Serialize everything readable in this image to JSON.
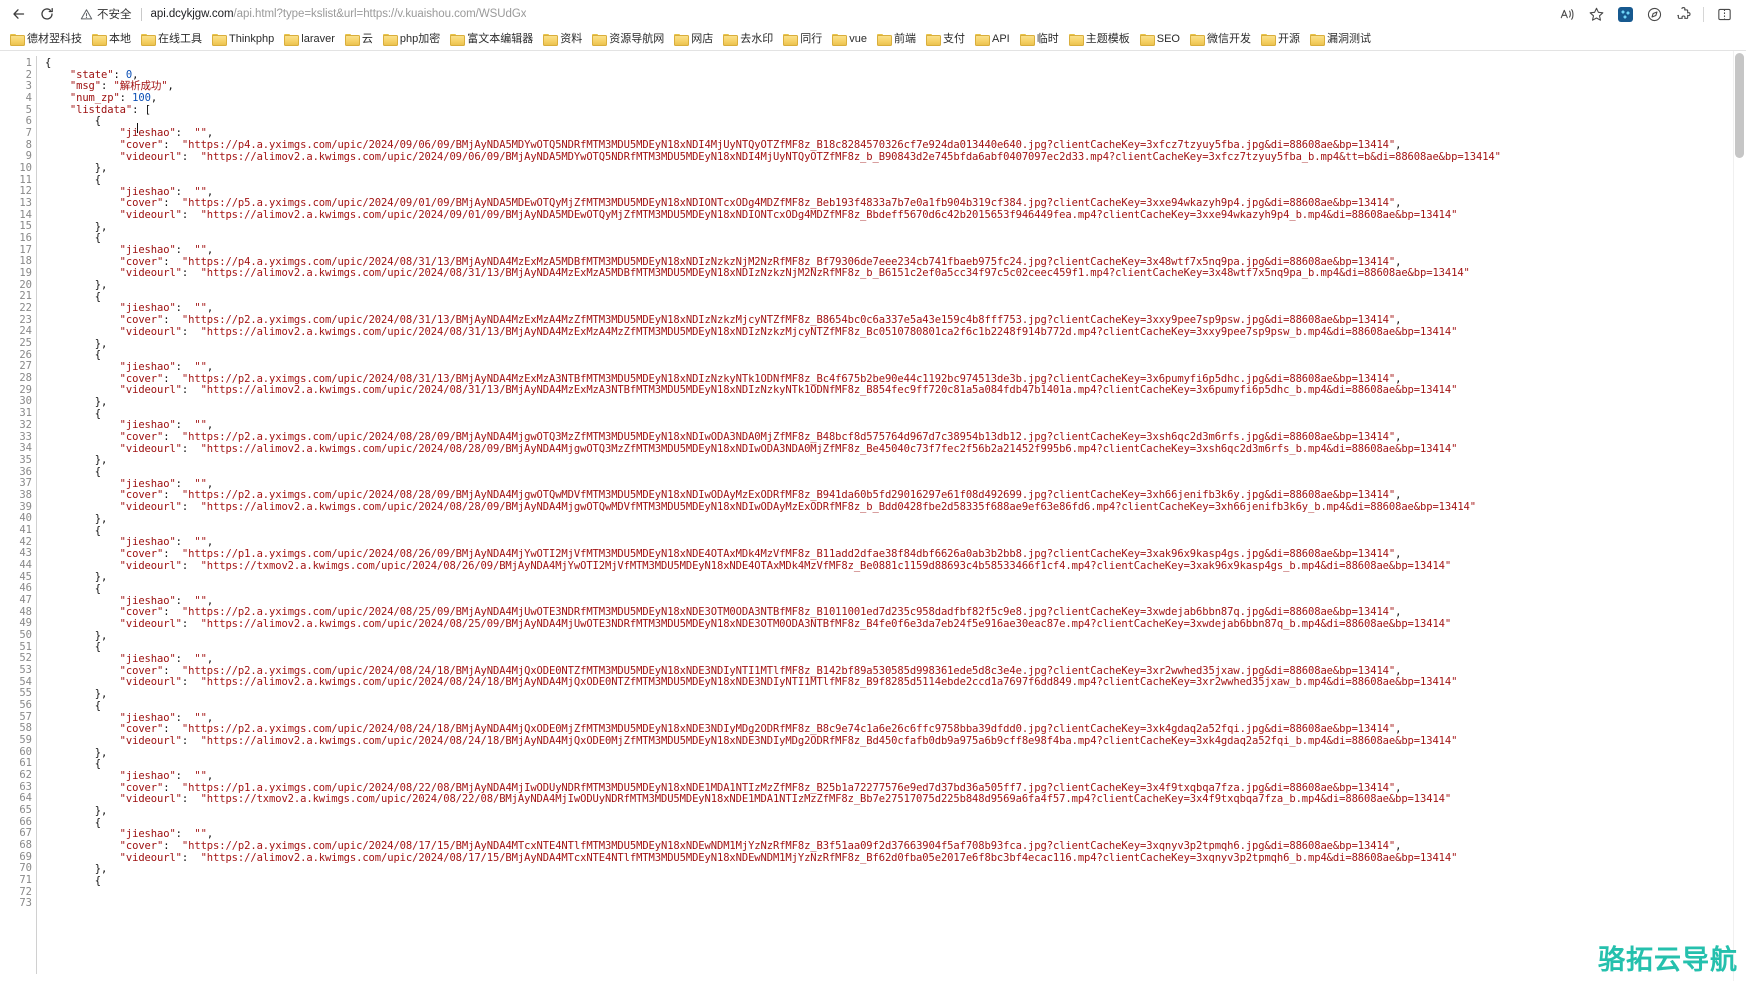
{
  "browser": {
    "back_label": "Back",
    "reload_label": "Reload",
    "security": {
      "warning_icon": "warning-triangle-icon",
      "label": "不安全"
    },
    "url": {
      "host": "api.dcykjgw.com",
      "path": "/api.html?type=kslist&url=https://v.kuaishou.com/WSUdGx",
      "full": "api.dcykjgw.com/api.html?type=kslist&url=https://v.kuaishou.com/WSUdGx"
    },
    "toolbar_right": [
      {
        "name": "read-aloud-icon",
        "glyph": "A"
      },
      {
        "name": "favorite-star-icon",
        "glyph": "☆"
      },
      {
        "name": "extension-blue-icon",
        "glyph": ""
      },
      {
        "name": "collections-icon",
        "glyph": "◎"
      },
      {
        "name": "extensions-puzzle-icon",
        "glyph": "🧩"
      },
      {
        "name": "split-screen-icon",
        "glyph": "▯"
      }
    ],
    "bookmarks": [
      "德材翌科技",
      "本地",
      "在线工具",
      "Thinkphp",
      "laraver",
      "云",
      "php加密",
      "富文本编辑器",
      "资料",
      "资源导航网",
      "网店",
      "去水印",
      "同行",
      "vue",
      "前端",
      "支付",
      "API",
      "临时",
      "主题模板",
      "SEO",
      "微信开发",
      "开源",
      "漏洞测试"
    ]
  },
  "watermark": "骆拓云导航",
  "response": {
    "state": 0,
    "msg": "解析成功",
    "num_zp": 100,
    "items": [
      {
        "jieshao": "",
        "cover": "https://p4.a.yximgs.com/upic/2024/09/06/09/BMjAyNDA5MDYwOTQ5NDRfMTM3MDU5MDEyN18xNDI4MjUyNTQyOTZfMF8z_B18c8284570326cf7e924da013440e640.jpg?clientCacheKey=3xfcz7tzyuy5fba.jpg&di=88608ae&bp=13414",
        "videourl": "https://alimov2.a.kwimgs.com/upic/2024/09/06/09/BMjAyNDA5MDYwOTQ5NDRfMTM3MDU5MDEyN18xNDI4MjUyNTQyOTZfMF8z_b_B90843d2e745bfda6abf0407097ec2d33.mp4?clientCacheKey=3xfcz7tzyuy5fba_b.mp4&tt=b&di=88608ae&bp=13414"
      },
      {
        "jieshao": "",
        "cover": "https://p5.a.yximgs.com/upic/2024/09/01/09/BMjAyNDA5MDEwOTQyMjZfMTM3MDU5MDEyN18xNDIONTcxODg4MDZfMF8z_Beb193f4833a7b7e0a1fb904b319cf384.jpg?clientCacheKey=3xxe94wkazyh9p4.jpg&di=88608ae&bp=13414",
        "videourl": "https://alimov2.a.kwimgs.com/upic/2024/09/01/09/BMjAyNDA5MDEwOTQyMjZfMTM3MDU5MDEyN18xNDIONTcxODg4MDZfMF8z_Bbdeff5670d6c42b2015653f946449fea.mp4?clientCacheKey=3xxe94wkazyh9p4_b.mp4&di=88608ae&bp=13414"
      },
      {
        "jieshao": "",
        "cover": "https://p4.a.yximgs.com/upic/2024/08/31/13/BMjAyNDA4MzExMzA5MDBfMTM3MDU5MDEyN18xNDIzNzkzNjM2NzRfMF8z_Bf79306de7eee234cb741fbaeb975fc24.jpg?clientCacheKey=3x48wtf7x5nq9pa.jpg&di=88608ae&bp=13414",
        "videourl": "https://alimov2.a.kwimgs.com/upic/2024/08/31/13/BMjAyNDA4MzExMzA5MDBfMTM3MDU5MDEyN18xNDIzNzkzNjM2NzRfMF8z_b_B6151c2ef0a5cc34f97c5c02ceec459f1.mp4?clientCacheKey=3x48wtf7x5nq9pa_b.mp4&di=88608ae&bp=13414"
      },
      {
        "jieshao": "",
        "cover": "https://p2.a.yximgs.com/upic/2024/08/31/13/BMjAyNDA4MzExMzA4MzZfMTM3MDU5MDEyN18xNDIzNzkzMjcyNTZfMF8z_B8654bc0c6a337e5a43e159c4b8fff753.jpg?clientCacheKey=3xxy9pee7sp9psw.jpg&di=88608ae&bp=13414",
        "videourl": "https://alimov2.a.kwimgs.com/upic/2024/08/31/13/BMjAyNDA4MzExMzA4MzZfMTM3MDU5MDEyN18xNDIzNzkzMjcyNTZfMF8z_Bc0510780801ca2f6c1b2248f914b772d.mp4?clientCacheKey=3xxy9pee7sp9psw_b.mp4&di=88608ae&bp=13414"
      },
      {
        "jieshao": "",
        "cover": "https://p2.a.yximgs.com/upic/2024/08/31/13/BMjAyNDA4MzExMzA3NTBfMTM3MDU5MDEyN18xNDIzNzkyNTk1ODNfMF8z_Bc4f675b2be90e44c1192bc974513de3b.jpg?clientCacheKey=3x6pumyfi6p5dhc.jpg&di=88608ae&bp=13414",
        "videourl": "https://alimov2.a.kwimgs.com/upic/2024/08/31/13/BMjAyNDA4MzExMzA3NTBfMTM3MDU5MDEyN18xNDIzNzkyNTk1ODNfMF8z_B854fec9ff720c81a5a084fdb47b1401a.mp4?clientCacheKey=3x6pumyfi6p5dhc_b.mp4&di=88608ae&bp=13414"
      },
      {
        "jieshao": "",
        "cover": "https://p2.a.yximgs.com/upic/2024/08/28/09/BMjAyNDA4MjgwOTQ3MzZfMTM3MDU5MDEyN18xNDIwODA3NDA0MjZfMF8z_B48bcf8d575764d967d7c38954b13db12.jpg?clientCacheKey=3xsh6qc2d3m6rfs.jpg&di=88608ae&bp=13414",
        "videourl": "https://alimov2.a.kwimgs.com/upic/2024/08/28/09/BMjAyNDA4MjgwOTQ3MzZfMTM3MDU5MDEyN18xNDIwODA3NDA0MjZfMF8z_Be45040c73f7fec2f56b2a21452f995b6.mp4?clientCacheKey=3xsh6qc2d3m6rfs_b.mp4&di=88608ae&bp=13414"
      },
      {
        "jieshao": "",
        "cover": "https://p2.a.yximgs.com/upic/2024/08/28/09/BMjAyNDA4MjgwOTQwMDVfMTM3MDU5MDEyN18xNDIwODAyMzExODRfMF8z_B941da60b5fd29016297e61f08d492699.jpg?clientCacheKey=3xh66jenifb3k6y.jpg&di=88608ae&bp=13414",
        "videourl": "https://alimov2.a.kwimgs.com/upic/2024/08/28/09/BMjAyNDA4MjgwOTQwMDVfMTM3MDU5MDEyN18xNDIwODAyMzExODRfMF8z_b_Bdd0428fbe2d58335f688ae9ef63e86fd6.mp4?clientCacheKey=3xh66jenifb3k6y_b.mp4&di=88608ae&bp=13414"
      },
      {
        "jieshao": "",
        "cover": "https://p1.a.yximgs.com/upic/2024/08/26/09/BMjAyNDA4MjYwOTI2MjVfMTM3MDU5MDEyN18xNDE4OTAxMDk4MzVfMF8z_B11add2dfae38f84dbf6626a0ab3b2bb8.jpg?clientCacheKey=3xak96x9kasp4gs.jpg&di=88608ae&bp=13414",
        "videourl": "https://txmov2.a.kwimgs.com/upic/2024/08/26/09/BMjAyNDA4MjYwOTI2MjVfMTM3MDU5MDEyN18xNDE4OTAxMDk4MzVfMF8z_Be0881c1159d88693c4b58533466f1cf4.mp4?clientCacheKey=3xak96x9kasp4gs_b.mp4&di=88608ae&bp=13414"
      },
      {
        "jieshao": "",
        "cover": "https://p2.a.yximgs.com/upic/2024/08/25/09/BMjAyNDA4MjUwOTE3NDRfMTM3MDU5MDEyN18xNDE3OTM0ODA3NTBfMF8z_B1011001ed7d235c958dadfbf82f5c9e8.jpg?clientCacheKey=3xwdejab6bbn87q.jpg&di=88608ae&bp=13414",
        "videourl": "https://alimov2.a.kwimgs.com/upic/2024/08/25/09/BMjAyNDA4MjUwOTE3NDRfMTM3MDU5MDEyN18xNDE3OTM0ODA3NTBfMF8z_B4fe0f6e3da7eb24f5e916ae30eac87e.mp4?clientCacheKey=3xwdejab6bbn87q_b.mp4&di=88608ae&bp=13414"
      },
      {
        "jieshao": "",
        "cover": "https://p2.a.yximgs.com/upic/2024/08/24/18/BMjAyNDA4MjQxODE0NTZfMTM3MDU5MDEyN18xNDE3NDIyNTI1MTlfMF8z_B142bf89a530585d998361ede5d8c3e4e.jpg?clientCacheKey=3xr2wwhed35jxaw.jpg&di=88608ae&bp=13414",
        "videourl": "https://alimov2.a.kwimgs.com/upic/2024/08/24/18/BMjAyNDA4MjQxODE0NTZfMTM3MDU5MDEyN18xNDE3NDIyNTI1MTlfMF8z_B9f8285d5114ebde2ccd1a7697f6dd849.mp4?clientCacheKey=3xr2wwhed35jxaw_b.mp4&di=88608ae&bp=13414"
      },
      {
        "jieshao": "",
        "cover": "https://p2.a.yximgs.com/upic/2024/08/24/18/BMjAyNDA4MjQxODE0MjZfMTM3MDU5MDEyN18xNDE3NDIyMDg2ODRfMF8z_B8c9e74c1a6e26c6ffc9758bba39dfdd0.jpg?clientCacheKey=3xk4gdaq2a52fqi.jpg&di=88608ae&bp=13414",
        "videourl": "https://alimov2.a.kwimgs.com/upic/2024/08/24/18/BMjAyNDA4MjQxODE0MjZfMTM3MDU5MDEyN18xNDE3NDIyMDg2ODRfMF8z_Bd450cfafb0db9a975a6b9cff8e98f4ba.mp4?clientCacheKey=3xk4gdaq2a52fqi_b.mp4&di=88608ae&bp=13414"
      },
      {
        "jieshao": "",
        "cover": "https://p1.a.yximgs.com/upic/2024/08/22/08/BMjAyNDA4MjIwODUyNDRfMTM3MDU5MDEyN18xNDE1MDA1NTIzMzZfMF8z_B25b1a72277576e9ed7d37bd36a505ff7.jpg?clientCacheKey=3x4f9txqbqa7fza.jpg&di=88608ae&bp=13414",
        "videourl": "https://txmov2.a.kwimgs.com/upic/2024/08/22/08/BMjAyNDA4MjIwODUyNDRfMTM3MDU5MDEyN18xNDE1MDA1NTIzMzZfMF8z_Bb7e27517075d225b848d9569a6fa4f57.mp4?clientCacheKey=3x4f9txqbqa7fza_b.mp4&di=88608ae&bp=13414"
      },
      {
        "jieshao": "",
        "cover": "https://p2.a.yximgs.com/upic/2024/08/17/15/BMjAyNDA4MTcxNTE4NTlfMTM3MDU5MDEyN18xNDEwNDM1MjYzNzRfMF8z_B3f51aa09f2d37663904f5af708b93fca.jpg?clientCacheKey=3xqnyv3p2tpmqh6.jpg&di=88608ae&bp=13414",
        "videourl": "https://alimov2.a.kwimgs.com/upic/2024/08/17/15/BMjAyNDA4MTcxNTE4NTlfMTM3MDU5MDEyN18xNDEwNDM1MjYzNzRfMF8z_Bf62d0fba05e2017e6f8bc3bf4ecac116.mp4?clientCacheKey=3xqnyv3p2tpmqh6_b.mp4&di=88608ae&bp=13414"
      }
    ]
  }
}
